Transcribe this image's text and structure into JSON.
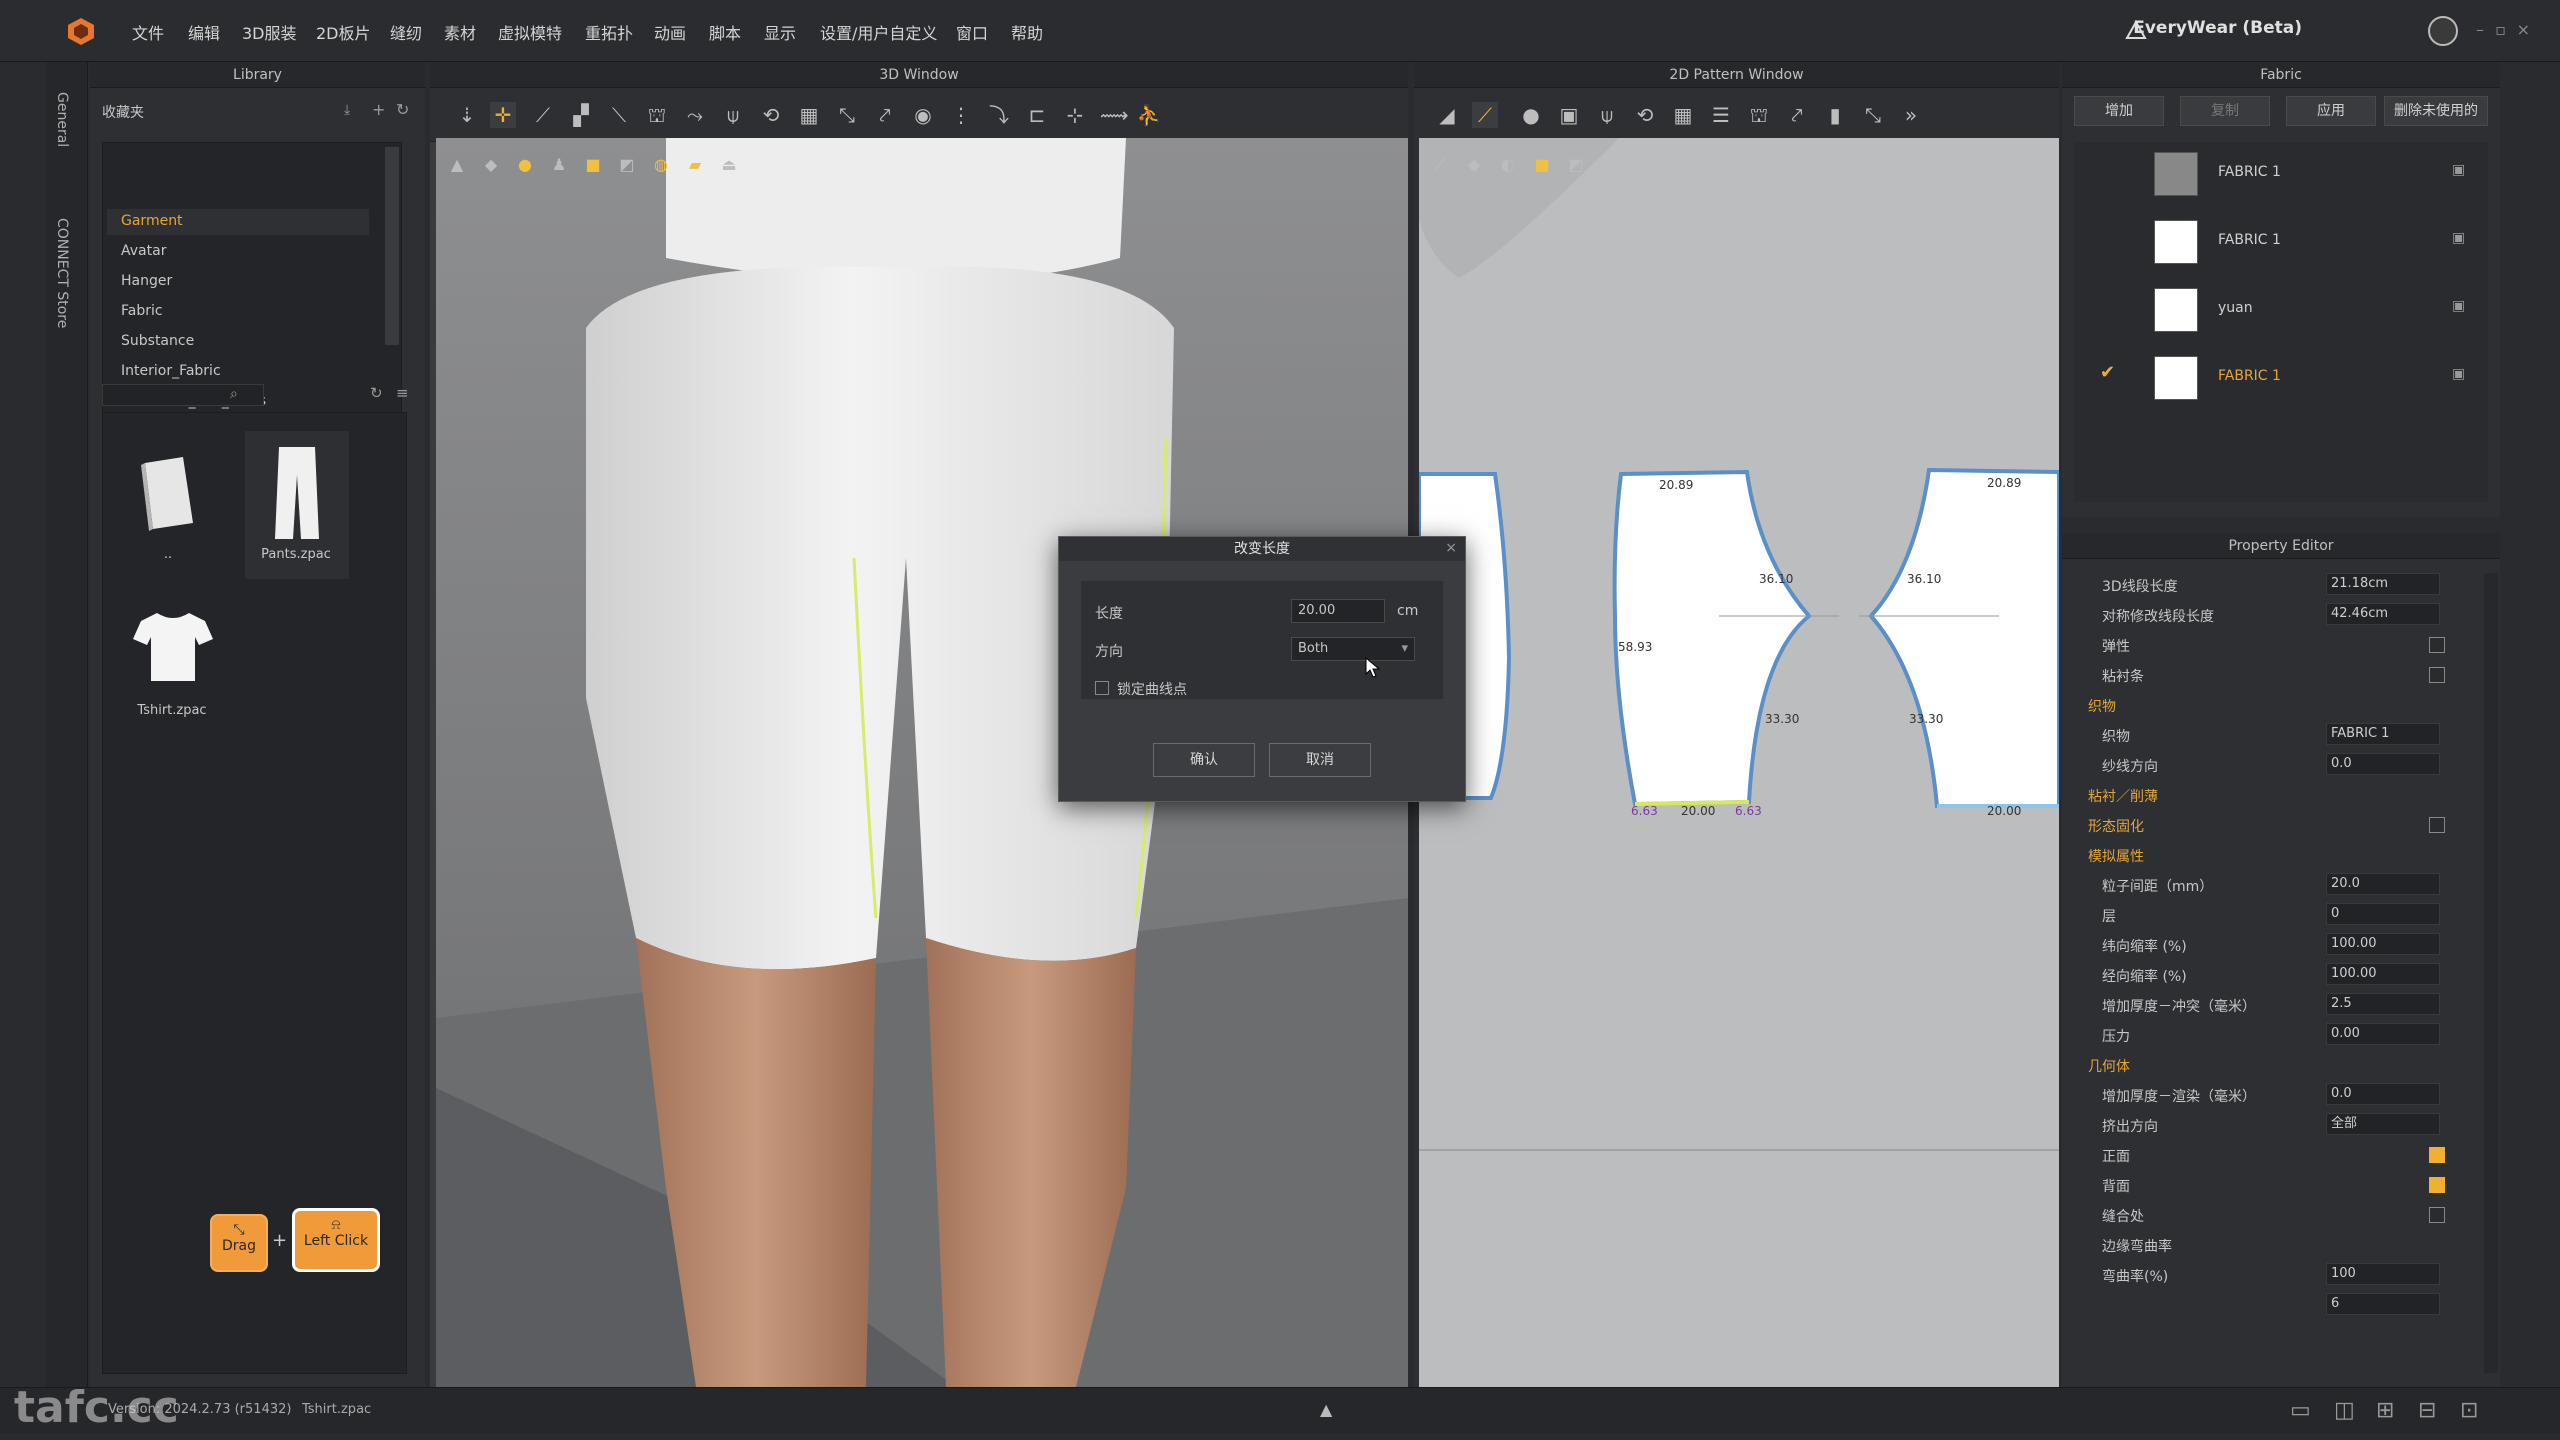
{
  "menubar": {
    "items": [
      "文件",
      "编辑",
      "3D服装",
      "2D板片",
      "缝纫",
      "素材",
      "虚拟模特",
      "重拓扑",
      "动画",
      "脚本",
      "显示",
      "设置/用户自定义",
      "窗口",
      "帮助"
    ],
    "brand": "EveryWear (Beta)"
  },
  "leftstrip": {
    "tab_general": "General",
    "tab_connect": "CONNECT Store"
  },
  "library": {
    "title": "Library",
    "favorites": "收藏夹",
    "items": [
      "Garment",
      "Avatar",
      "Hanger",
      "Fabric",
      "Substance",
      "Interior_Fabric",
      "Hardware_and_Trims"
    ],
    "thumbs": [
      "..",
      "Pants.zpac",
      "Tshirt.zpac"
    ]
  },
  "win3d": {
    "title": "3D Window"
  },
  "win2d": {
    "title": "2D Pattern Window",
    "measures": [
      "20.89",
      "20.89",
      "36.10",
      "36.10",
      "58.93",
      "33.30",
      "33.30",
      "20.00",
      "20.00",
      "6.63",
      "6.63"
    ]
  },
  "fabric": {
    "title": "Fabric",
    "buttons": [
      "增加",
      "复制",
      "应用",
      "删除未使用的"
    ],
    "rows": [
      "FABRIC 1",
      "FABRIC 1",
      "yuan",
      "FABRIC 1"
    ],
    "swatch_colors": [
      "#888888",
      "#ffffff",
      "#ffffff",
      "#ffffff"
    ]
  },
  "prop": {
    "title": "Property Editor",
    "rows": [
      {
        "label": "3D线段长度",
        "val": "21.18cm",
        "sec": false
      },
      {
        "label": "对称修改线段长度",
        "val": "42.46cm",
        "sec": false
      },
      {
        "label": "弹性",
        "check": false
      },
      {
        "label": "粘衬条",
        "check": false
      },
      {
        "label": "织物",
        "sec": true
      },
      {
        "label": "织物",
        "val": "FABRIC 1"
      },
      {
        "label": "纱线方向",
        "val": "0.0"
      },
      {
        "label": "粘衬／削薄",
        "sec": true
      },
      {
        "label": "形态固化",
        "sec": true,
        "check": false
      },
      {
        "label": "模拟属性",
        "sec": true
      },
      {
        "label": "粒子间距（mm）",
        "val": "20.0"
      },
      {
        "label": "层",
        "val": "0"
      },
      {
        "label": "纬向缩率 (%)",
        "val": "100.00"
      },
      {
        "label": "经向缩率 (%)",
        "val": "100.00"
      },
      {
        "label": "增加厚度－冲突（毫米）",
        "val": "2.5"
      },
      {
        "label": "压力",
        "val": "0.00"
      },
      {
        "label": "几何体",
        "sec": true
      },
      {
        "label": "增加厚度－渲染（毫米）",
        "val": "0.0"
      },
      {
        "label": "挤出方向",
        "val": "全部"
      },
      {
        "label": "正面",
        "check": true
      },
      {
        "label": "背面",
        "check": true
      },
      {
        "label": "缝合处",
        "check": false
      },
      {
        "label": "边缘弯曲率",
        "sec": false
      },
      {
        "label": "弯曲率(%)",
        "val": "100"
      },
      {
        "label": "",
        "val": "6"
      }
    ]
  },
  "dialog": {
    "title": "改变长度",
    "length_label": "长度",
    "length_value": "20.00",
    "unit": "cm",
    "direction_label": "方向",
    "direction_value": "Both",
    "lock_label": "锁定曲线点",
    "ok": "确认",
    "cancel": "取消"
  },
  "hints": {
    "drag": "Drag",
    "left_click": "Left Click"
  },
  "status": {
    "version": "Version: 2024.2.73 (r51432)",
    "file": "Tshirt.zpac",
    "watermark": "tafc.cc"
  },
  "colors": {
    "accent": "#f0a030",
    "pattern_stroke": "#5a8fc8"
  }
}
